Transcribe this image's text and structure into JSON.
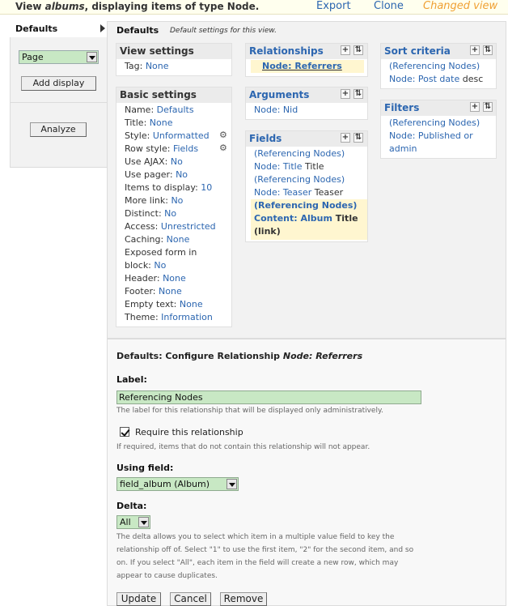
{
  "header": {
    "title_prefix": "View ",
    "title_view": "albums",
    "title_suffix": ", displaying items of type Node.",
    "export": "Export",
    "clone": "Clone",
    "changed_view": "Changed view"
  },
  "tabs": {
    "defaults": "Defaults",
    "display_select": "Page",
    "add_display": "Add display",
    "analyze": "Analyze"
  },
  "main": {
    "heading": "Defaults",
    "subheading": "Default settings for this view."
  },
  "view_settings": {
    "title": "View settings",
    "tag_label": "Tag: ",
    "tag_value": "None"
  },
  "basic_settings": {
    "title": "Basic settings",
    "name_label": "Name: ",
    "name_value": "Defaults",
    "title_label": "Title: ",
    "title_value": "None",
    "style_label": "Style: ",
    "style_value": "Unformatted",
    "row_style_label": "Row style: ",
    "row_style_value": "Fields",
    "ajax_label": "Use AJAX: ",
    "ajax_value": "No",
    "pager_label": "Use pager: ",
    "pager_value": "No",
    "items_label": "Items to display: ",
    "items_value": "10",
    "more_label": "More link: ",
    "more_value": "No",
    "distinct_label": "Distinct: ",
    "distinct_value": "No",
    "access_label": "Access: ",
    "access_value": "Unrestricted",
    "caching_label": "Caching: ",
    "caching_value": "None",
    "exposed_label_1": "Exposed form in",
    "exposed_label_2": "block: ",
    "exposed_value": "No",
    "header_label": "Header: ",
    "header_value": "None",
    "footer_label": "Footer: ",
    "footer_value": "None",
    "empty_label": "Empty text: ",
    "empty_value": "None",
    "theme_label": "Theme: ",
    "theme_value": "Information"
  },
  "relationships": {
    "title": "Relationships",
    "item": "Node: Referrers"
  },
  "arguments": {
    "title": "Arguments",
    "item": "Node: Nid"
  },
  "fields": {
    "title": "Fields",
    "f1a": "(Referencing Nodes)",
    "f1b": "Node: Title",
    "f1c": " Title",
    "f2a": "(Referencing Nodes)",
    "f2b": "Node: Teaser",
    "f2c": " Teaser",
    "f3a": "(Referencing Nodes)",
    "f3b": "Content: Album",
    "f3c": " Title",
    "f3d": "(link)"
  },
  "sort_criteria": {
    "title": "Sort criteria",
    "s1a": "(Referencing Nodes)",
    "s1b": "Node: Post date",
    "s1c": " desc"
  },
  "filters": {
    "title": "Filters",
    "f1a": "(Referencing Nodes)",
    "f1b": "Node: Published or",
    "f1c": "admin"
  },
  "configure": {
    "heading_prefix": "Defaults: Configure Relationship ",
    "heading_item": "Node: Referrers",
    "label_label": "Label:",
    "label_value": "Referencing Nodes",
    "label_desc": "The label for this relationship that will be displayed only administratively.",
    "require_label": "Require this relationship",
    "require_desc": "If required, items that do not contain this relationship will not appear.",
    "using_label": "Using field:",
    "using_value": "field_album (Album)",
    "delta_label": "Delta:",
    "delta_value": "All",
    "delta_desc_1": "The delta allows you to select which item in a multiple value field to key the",
    "delta_desc_2": "relationship off of. Select \"1\" to use the first item, \"2\" for the second item, and so",
    "delta_desc_3": "on. If you select \"All\", each item in the field will create a new row, which may",
    "delta_desc_4": "appear to cause duplicates.",
    "update": "Update",
    "cancel": "Cancel",
    "remove": "Remove"
  },
  "icons": {
    "add": "+",
    "rearrange": "⇅",
    "gear": "⚙"
  }
}
